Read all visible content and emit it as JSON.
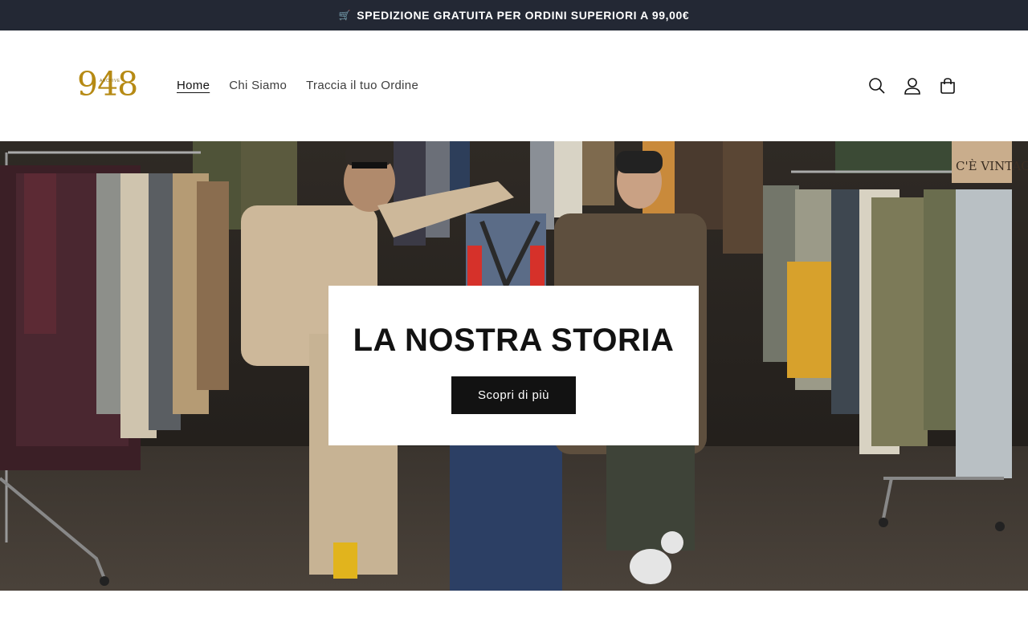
{
  "announcement": {
    "icon": "shopping-cart-emoji",
    "text": "SPEDIZIONE GRATUITA PER ORDINI SUPERIORI A 99,00€"
  },
  "header": {
    "logo_text": "948",
    "logo_subtext": "ARCHIVE",
    "nav": [
      {
        "label": "Home",
        "active": true
      },
      {
        "label": "Chi Siamo",
        "active": false
      },
      {
        "label": "Traccia il tuo Ordine",
        "active": false
      }
    ],
    "icons": [
      "search-icon",
      "account-icon",
      "cart-icon"
    ]
  },
  "hero": {
    "title": "LA NOSTRA STORIA",
    "button_label": "Scopri di più",
    "sign_text": "C'È VINTAGE"
  },
  "colors": {
    "announcement_bg": "#232834",
    "logo_gold": "#b68a14",
    "button_bg": "#121212"
  }
}
